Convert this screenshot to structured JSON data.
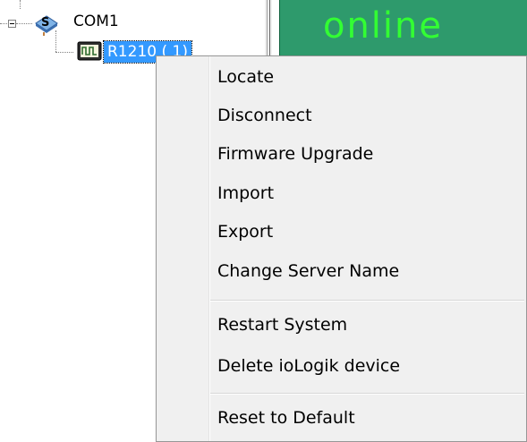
{
  "tree": {
    "root_label": "COM1",
    "device_label": "R1210 ( 1)"
  },
  "status": {
    "text": "online",
    "background_color": "#2e9a6c",
    "text_color": "#33ff33"
  },
  "context_menu": {
    "items": [
      {
        "label": "Locate"
      },
      {
        "label": "Disconnect"
      },
      {
        "label": "Firmware Upgrade"
      },
      {
        "label": "Import"
      },
      {
        "label": "Export"
      },
      {
        "label": "Change Server Name"
      },
      {
        "label": "Restart System"
      },
      {
        "label": "Delete ioLogik device"
      },
      {
        "label": "Reset to Default"
      }
    ]
  },
  "icons": {
    "com_port": "network-port-icon",
    "device": "io-device-icon",
    "expander": "tree-collapse-icon"
  }
}
